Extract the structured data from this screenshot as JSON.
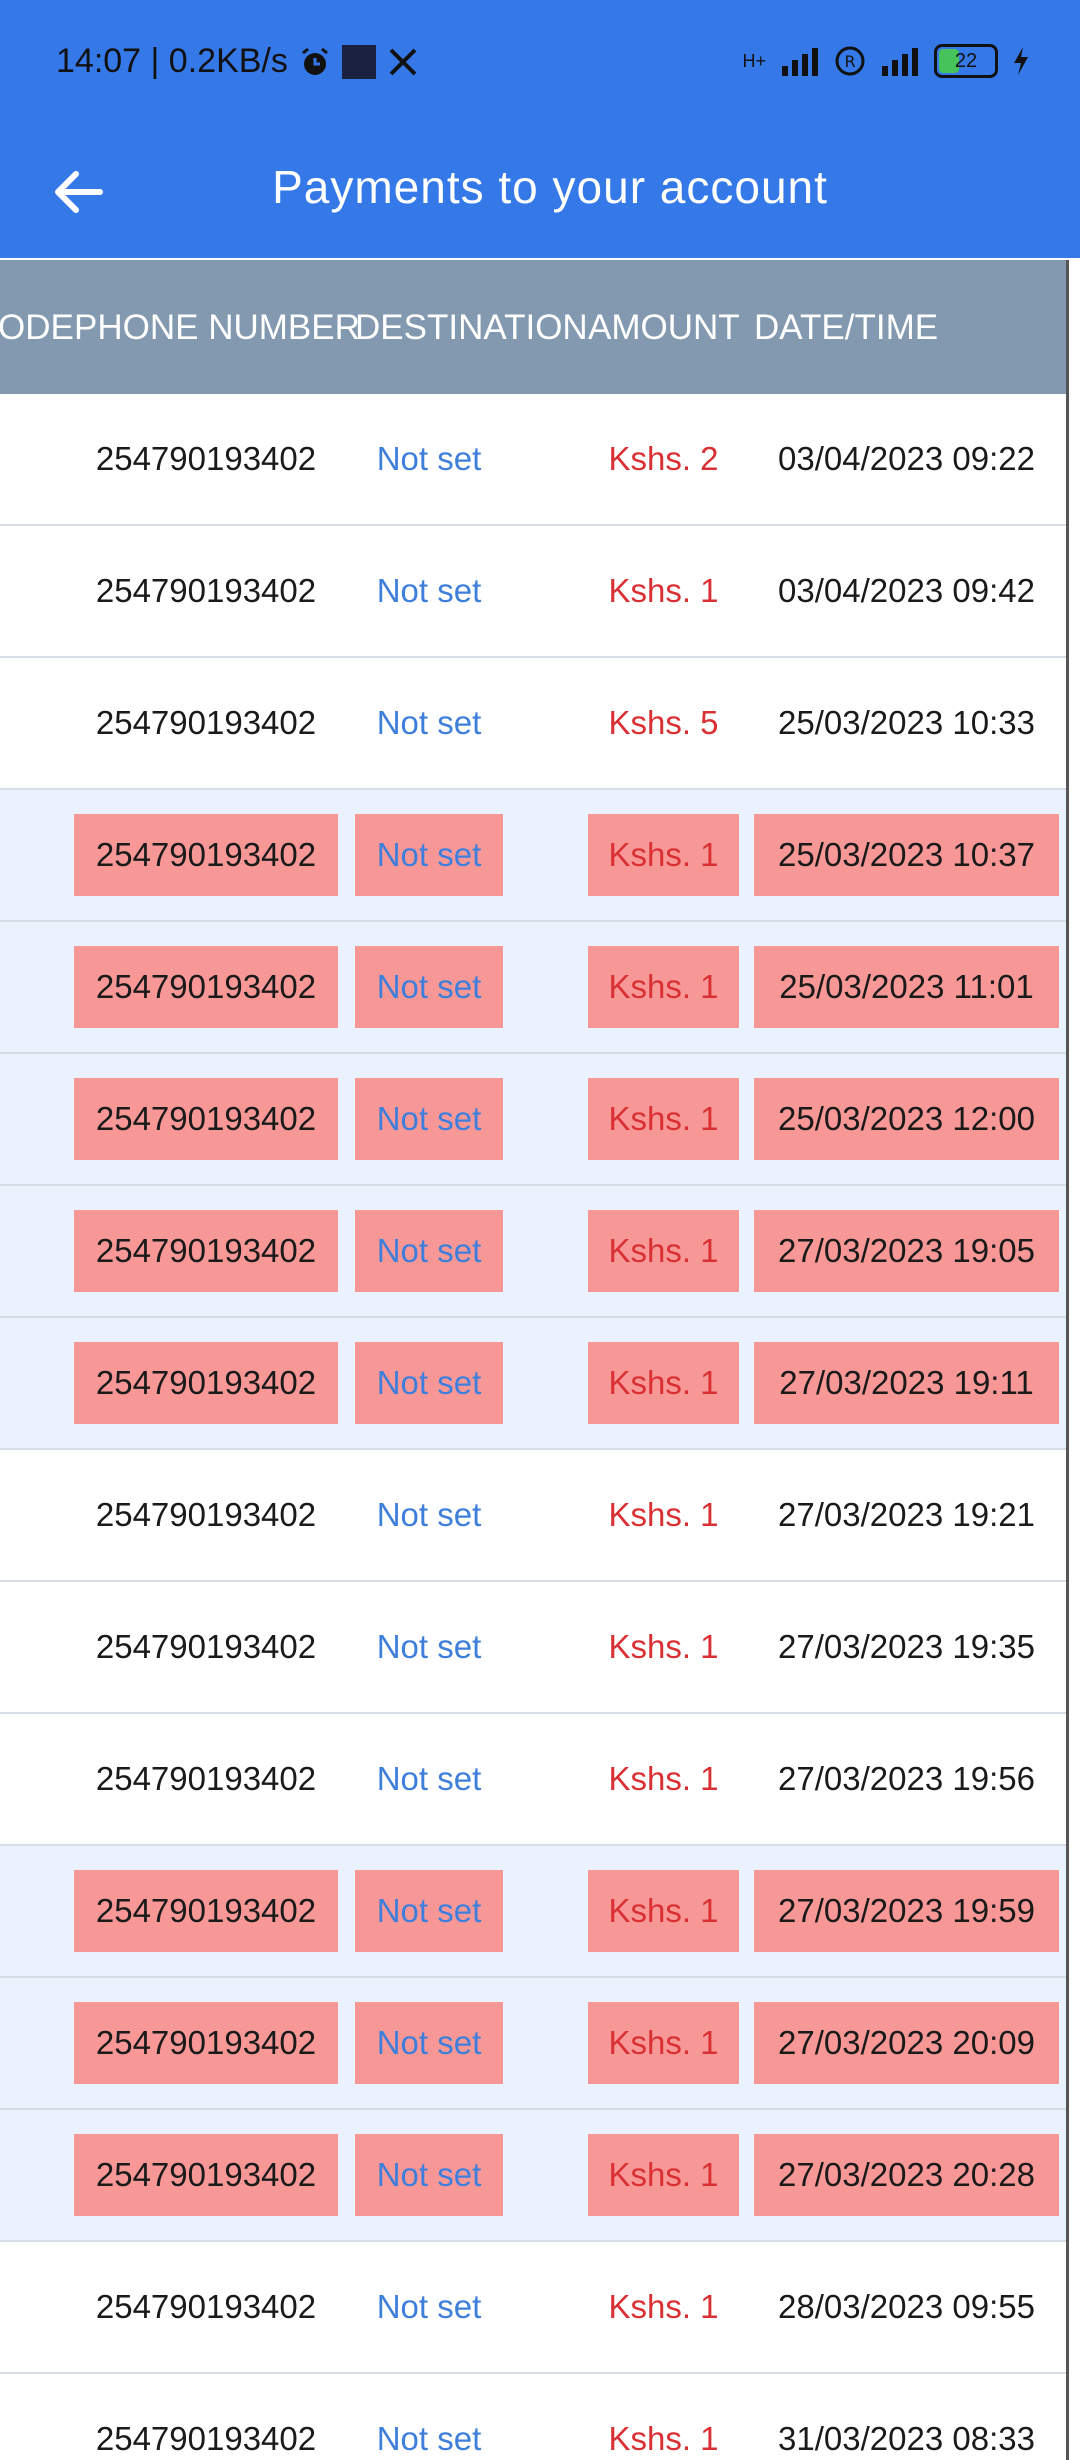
{
  "status_bar": {
    "time_speed": "14:07 | 0.2KB/s",
    "network": "H+",
    "battery": "22",
    "icons": [
      "alarm-icon",
      "app-square-icon",
      "x-logo-icon",
      "signal-icon",
      "registered-icon",
      "signal-icon",
      "battery-icon",
      "charging-icon"
    ]
  },
  "app_bar": {
    "title": "Payments to your account",
    "back_icon": "arrow-left-icon"
  },
  "colors": {
    "app_bar": "#3579e9",
    "header_bg": "#8299b0",
    "highlight": "#f79897",
    "destination_text": "#3f7fdc",
    "amount_text": "#d93033"
  },
  "table": {
    "headers": {
      "code": "ODE",
      "phone": "PHONE NUMBER",
      "destination": "DESTINATION",
      "amount": "AMOUNT",
      "datetime": "DATE/TIME"
    },
    "rows": [
      {
        "phone": "254790193402",
        "destination": "Not set",
        "amount": "Kshs. 2",
        "datetime": "03/04/2023 09:22",
        "highlighted": false
      },
      {
        "phone": "254790193402",
        "destination": "Not set",
        "amount": "Kshs. 1",
        "datetime": "03/04/2023 09:42",
        "highlighted": false
      },
      {
        "phone": "254790193402",
        "destination": "Not set",
        "amount": "Kshs. 5",
        "datetime": "25/03/2023 10:33",
        "highlighted": false
      },
      {
        "phone": "254790193402",
        "destination": "Not set",
        "amount": "Kshs. 1",
        "datetime": "25/03/2023 10:37",
        "highlighted": true
      },
      {
        "phone": "254790193402",
        "destination": "Not set",
        "amount": "Kshs. 1",
        "datetime": "25/03/2023 11:01",
        "highlighted": true
      },
      {
        "phone": "254790193402",
        "destination": "Not set",
        "amount": "Kshs. 1",
        "datetime": "25/03/2023 12:00",
        "highlighted": true
      },
      {
        "phone": "254790193402",
        "destination": "Not set",
        "amount": "Kshs. 1",
        "datetime": "27/03/2023 19:05",
        "highlighted": true
      },
      {
        "phone": "254790193402",
        "destination": "Not set",
        "amount": "Kshs. 1",
        "datetime": "27/03/2023 19:11",
        "highlighted": true
      },
      {
        "phone": "254790193402",
        "destination": "Not set",
        "amount": "Kshs. 1",
        "datetime": "27/03/2023 19:21",
        "highlighted": false
      },
      {
        "phone": "254790193402",
        "destination": "Not set",
        "amount": "Kshs. 1",
        "datetime": "27/03/2023 19:35",
        "highlighted": false
      },
      {
        "phone": "254790193402",
        "destination": "Not set",
        "amount": "Kshs. 1",
        "datetime": "27/03/2023 19:56",
        "highlighted": false
      },
      {
        "phone": "254790193402",
        "destination": "Not set",
        "amount": "Kshs. 1",
        "datetime": "27/03/2023 19:59",
        "highlighted": true
      },
      {
        "phone": "254790193402",
        "destination": "Not set",
        "amount": "Kshs. 1",
        "datetime": "27/03/2023 20:09",
        "highlighted": true
      },
      {
        "phone": "254790193402",
        "destination": "Not set",
        "amount": "Kshs. 1",
        "datetime": "27/03/2023 20:28",
        "highlighted": true
      },
      {
        "phone": "254790193402",
        "destination": "Not set",
        "amount": "Kshs. 1",
        "datetime": "28/03/2023 09:55",
        "highlighted": false
      },
      {
        "phone": "254790193402",
        "destination": "Not set",
        "amount": "Kshs. 1",
        "datetime": "31/03/2023 08:33",
        "highlighted": false
      }
    ]
  }
}
